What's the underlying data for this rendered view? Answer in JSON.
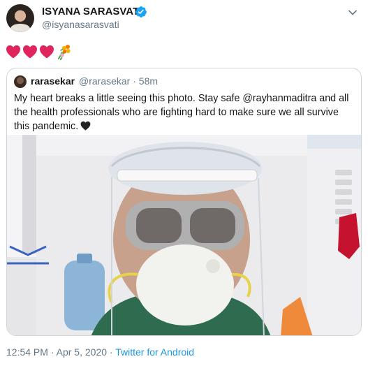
{
  "tweet": {
    "author_name": "ISYANA SARASVATI",
    "author_handle": "@isyanasarasvati",
    "body_icons": [
      "red-heart-icon",
      "red-heart-icon",
      "red-heart-icon",
      "bouquet-icon"
    ],
    "time": "12:54 PM",
    "separator": "·",
    "date": "Apr 5, 2020",
    "source": "Twitter for Android"
  },
  "quoted_tweet": {
    "author_name": "rarasekar",
    "author_handle": "@rarasekar",
    "separator": "·",
    "age": "58m",
    "text": "My heart breaks a little seeing this photo. Stay safe @rayhanmaditra and all the health professionals who are fighting hard to make sure we all survive this pandemic.",
    "trailing_icon": "black-heart-icon"
  },
  "colors": {
    "verified_blue": "#1da1f2",
    "link_blue": "#1b95e0",
    "heart_red": "#e0245e",
    "secondary_text": "#657786",
    "border": "#ccd6dd"
  }
}
